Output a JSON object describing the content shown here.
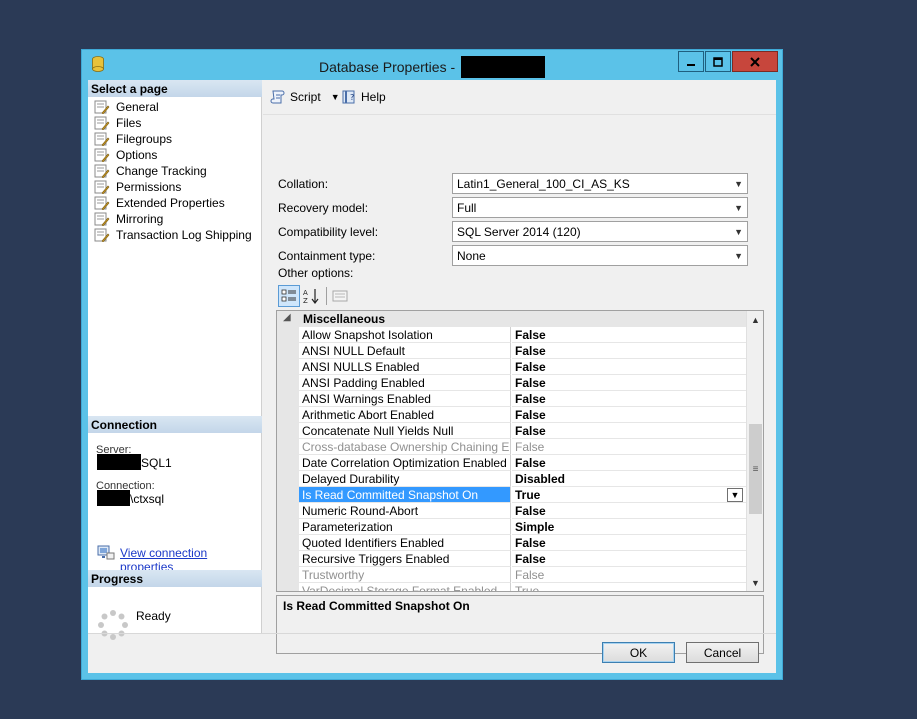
{
  "window": {
    "title": "Database Properties - "
  },
  "sidebar": {
    "select_page_header": "Select a page",
    "pages": [
      "General",
      "Files",
      "Filegroups",
      "Options",
      "Change Tracking",
      "Permissions",
      "Extended Properties",
      "Mirroring",
      "Transaction Log Shipping"
    ],
    "connection_header": "Connection",
    "server_label": "Server:",
    "server_value": "SQL1",
    "connection_label": "Connection:",
    "connection_value": "\\ctxsql",
    "view_connection_link": "View connection properties",
    "progress_header": "Progress",
    "progress_status": "Ready"
  },
  "toolbar": {
    "script_label": "Script",
    "help_label": "Help"
  },
  "options": {
    "collation_label": "Collation:",
    "collation_value": "Latin1_General_100_CI_AS_KS",
    "recovery_label": "Recovery model:",
    "recovery_value": "Full",
    "compat_label": "Compatibility level:",
    "compat_value": "SQL Server 2014 (120)",
    "containment_label": "Containment type:",
    "containment_value": "None",
    "other_options_label": "Other options:"
  },
  "grid": {
    "category": "Miscellaneous",
    "rows": [
      {
        "name": "Allow Snapshot Isolation",
        "value": "False"
      },
      {
        "name": "ANSI NULL Default",
        "value": "False"
      },
      {
        "name": "ANSI NULLS Enabled",
        "value": "False"
      },
      {
        "name": "ANSI Padding Enabled",
        "value": "False"
      },
      {
        "name": "ANSI Warnings Enabled",
        "value": "False"
      },
      {
        "name": "Arithmetic Abort Enabled",
        "value": "False"
      },
      {
        "name": "Concatenate Null Yields Null",
        "value": "False"
      },
      {
        "name": "Cross-database Ownership Chaining Enabled",
        "value": "False"
      },
      {
        "name": "Date Correlation Optimization Enabled",
        "value": "False"
      },
      {
        "name": "Delayed Durability",
        "value": "Disabled"
      },
      {
        "name": "Is Read Committed Snapshot On",
        "value": "True"
      },
      {
        "name": "Numeric Round-Abort",
        "value": "False"
      },
      {
        "name": "Parameterization",
        "value": "Simple"
      },
      {
        "name": "Quoted Identifiers Enabled",
        "value": "False"
      },
      {
        "name": "Recursive Triggers Enabled",
        "value": "False"
      },
      {
        "name": "Trustworthy",
        "value": "False"
      },
      {
        "name": "VarDecimal Storage Format Enabled",
        "value": "True"
      }
    ],
    "description_title": "Is Read Committed Snapshot On"
  },
  "buttons": {
    "ok": "OK",
    "cancel": "Cancel"
  },
  "colors": {
    "desktop": "#2b3a56",
    "window_frame": "#5bc2e8",
    "close_button": "#c7463c",
    "selection": "#3399ff",
    "link": "#1a38c8"
  }
}
